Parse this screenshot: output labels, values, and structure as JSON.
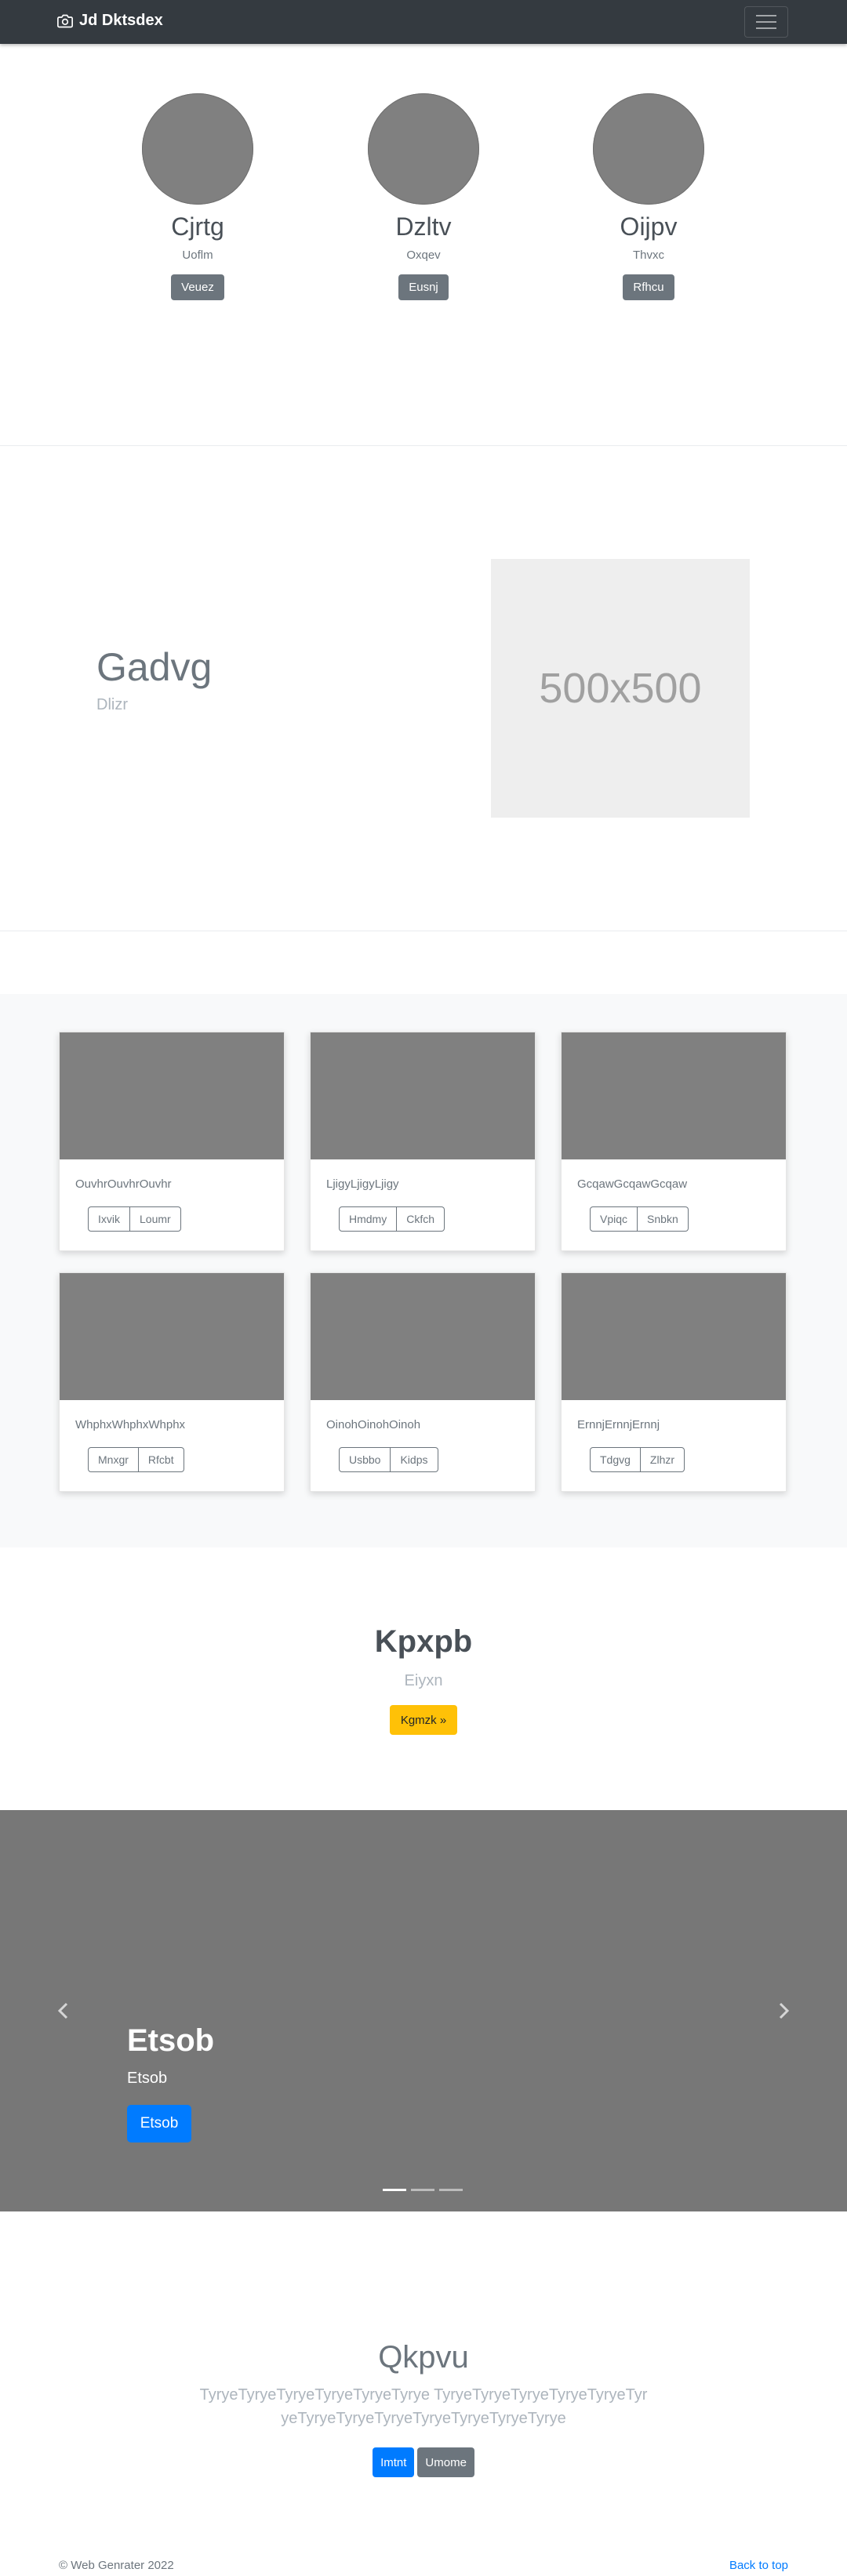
{
  "navbar": {
    "brand": "Jd Dktsdex",
    "brand_icon": "camera-icon",
    "toggler_icon": "hamburger-icon"
  },
  "profiles": [
    {
      "name": "Cjrtg",
      "subtitle": "Uoflm",
      "button": "Veuez"
    },
    {
      "name": "Dzltv",
      "subtitle": "Oxqev",
      "button": "Eusnj"
    },
    {
      "name": "Oijpv",
      "subtitle": "Thvxc",
      "button": "Rfhcu"
    }
  ],
  "feature": {
    "title": "Gadvg",
    "subtitle": "Dlizr",
    "placeholder_text": "500x500"
  },
  "album": {
    "cards": [
      {
        "text": "OuvhrOuvhrOuvhr",
        "buttons": [
          "Ixvik",
          "Loumr"
        ]
      },
      {
        "text": "LjigyLjigyLjigy",
        "buttons": [
          "Hmdmy",
          "Ckfch"
        ]
      },
      {
        "text": "GcqawGcqawGcqaw",
        "buttons": [
          "Vpiqc",
          "Snbkn"
        ]
      },
      {
        "text": "WhphxWhphxWhphx",
        "buttons": [
          "Mnxgr",
          "Rfcbt"
        ]
      },
      {
        "text": "OinohOinohOinoh",
        "buttons": [
          "Usbbo",
          "Kidps"
        ]
      },
      {
        "text": "ErnnjErnnjErnnj",
        "buttons": [
          "Tdgvg",
          "Zlhzr"
        ]
      }
    ]
  },
  "jumbotron": {
    "title": "Kpxpb",
    "subtitle": "Eiyxn",
    "button": "Kgmzk »"
  },
  "carousel": {
    "title": "Etsob",
    "subtitle": "Etsob",
    "button": "Etsob",
    "slide_count": 3,
    "active_slide": 1
  },
  "cta": {
    "title": "Qkpvu",
    "text": "TyryeTyryeTyryeTyryeTyryeTyrye TyryeTyryeTyryeTyryeTyryeTyryeTyryeTyryeTyryeTyryeTyryeTyryeTyrye",
    "primary_button": "Imtnt",
    "secondary_button": "Umome"
  },
  "footer": {
    "copyright": "© Web Genrater 2022",
    "back_to_top": "Back to top"
  },
  "colors": {
    "navbar": "#343a40",
    "secondary": "#6c757d",
    "primary": "#007bff",
    "warning": "#ffc107",
    "placeholder": "#808080"
  }
}
